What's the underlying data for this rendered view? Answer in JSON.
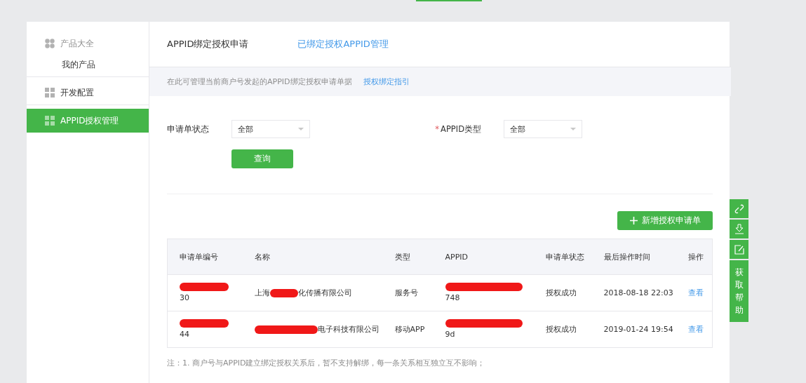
{
  "sidebar": {
    "items": [
      {
        "label": "产品大全",
        "kind": "group",
        "selected": false,
        "children": [
          {
            "label": "我的产品",
            "selected": false
          }
        ]
      },
      {
        "label": "开发配置",
        "kind": "item",
        "selected": false
      },
      {
        "label": "APPID授权管理",
        "kind": "item",
        "selected": true
      }
    ]
  },
  "tabs": [
    {
      "label": "APPID绑定授权申请",
      "selected": true
    },
    {
      "label": "已绑定授权APPID管理",
      "selected": false
    }
  ],
  "notice": {
    "text": "在此可管理当前商户号发起的APPID绑定授权申请单据",
    "link": "授权绑定指引"
  },
  "required_mark": "*",
  "filters": [
    {
      "label": "申请单状态",
      "required": false,
      "value": "全部"
    },
    {
      "label": "APPID类型",
      "required": true,
      "value": "全部"
    }
  ],
  "query_button": "查询",
  "add_button": "新增授权申请单",
  "table": {
    "columns": [
      "申请单编号",
      "名称",
      "类型",
      "APPID",
      "申请单状态",
      "最后操作时间",
      "操作"
    ],
    "rows": [
      {
        "number": "30",
        "name": {
          "before": "上海",
          "after": "化传播有限公司"
        },
        "type": "服务号",
        "appid": "748",
        "status": "授权成功",
        "time": "2018-08-18 22:03",
        "action": "查看"
      },
      {
        "number": "44",
        "name": {
          "after": "电子科技有限公司"
        },
        "type": "移动APP",
        "appid": "9d",
        "status": "授权成功",
        "time": "2019-01-24 19:54",
        "action": "查看"
      }
    ]
  },
  "footnote": "注：1. 商户号与APPID建立绑定授权关系后，暂不支持解绑，每一条关系相互独立互不影响；",
  "float_tools": {
    "help": "获取帮助"
  }
}
